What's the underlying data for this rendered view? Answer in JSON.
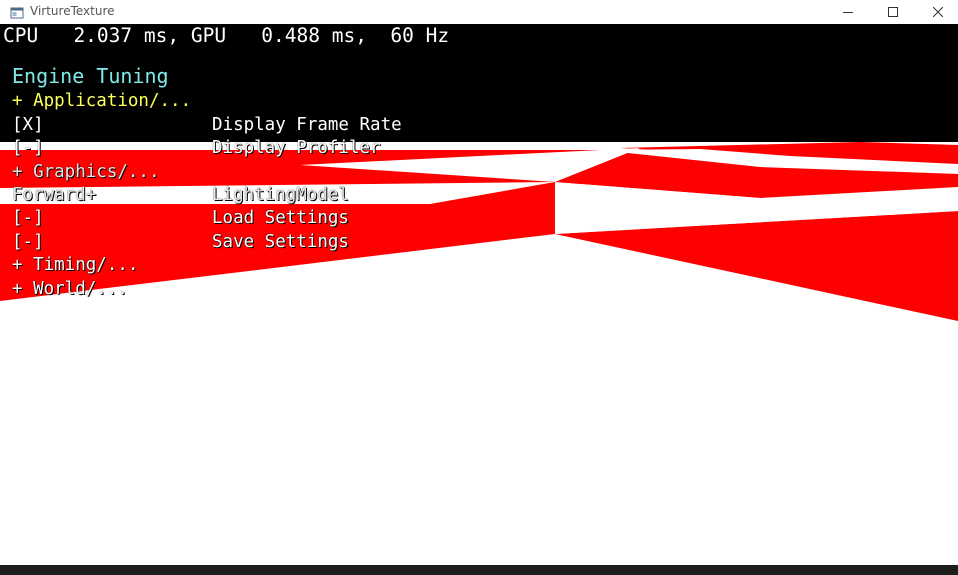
{
  "window": {
    "title": "VirtureTexture",
    "icon": "app-window-icon",
    "controls": {
      "minimize_icon": "minimize-icon",
      "maximize_icon": "maximize-icon",
      "close_icon": "close-icon"
    }
  },
  "hud": {
    "perf_text": "CPU   2.037 ms, GPU   0.488 ms,  60 Hz"
  },
  "engine_tuning": {
    "title": "Engine Tuning",
    "rows": [
      {
        "left": "+ Application/...",
        "right": ""
      },
      {
        "left": "[X]",
        "right": "Display Frame Rate"
      },
      {
        "left": "[-]",
        "right": "Display Profiler"
      },
      {
        "left": "+ Graphics/...",
        "right": ""
      },
      {
        "left": "Forward+",
        "right": "LightingModel"
      },
      {
        "left": "[-]",
        "right": "Load Settings"
      },
      {
        "left": "[-]",
        "right": "Save Settings"
      },
      {
        "left": "+ Timing/...",
        "right": ""
      },
      {
        "left": "+ World/...",
        "right": ""
      }
    ]
  },
  "scene": {
    "floor_color_a": "#ff0000",
    "floor_color_b": "#ffffff",
    "background_color": "#000000"
  },
  "colors": {
    "menu_title": "#7fe8e8",
    "menu_group": "#ffff55",
    "menu_item": "#ffffff"
  }
}
